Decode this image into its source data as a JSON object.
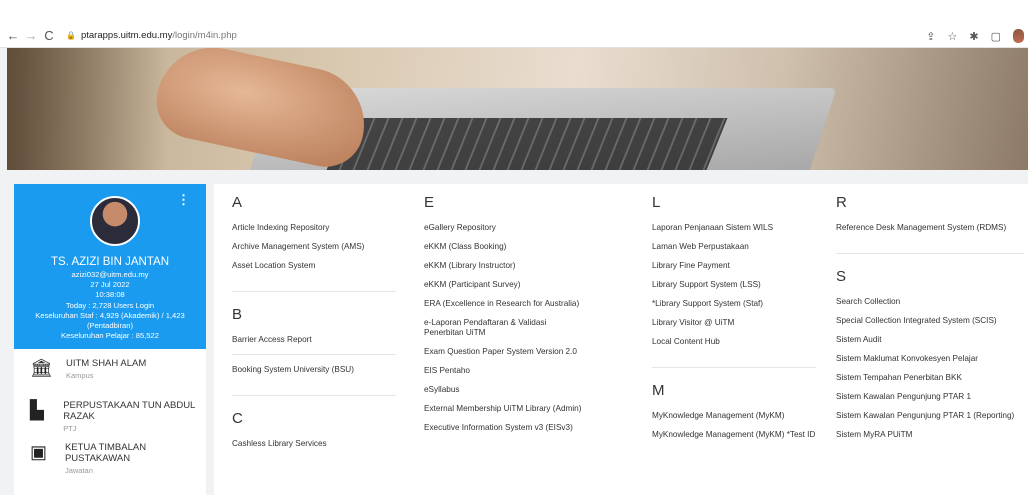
{
  "browser": {
    "url_host": "ptarapps.uitm.edu.my",
    "url_path": "/login/m4in.php"
  },
  "profile": {
    "name": "TS. AZIZI BIN JANTAN",
    "email": "azizi032@uitm.edu.my",
    "date": "27 Jul 2022",
    "time": "10:38:08",
    "today": "Today : 2,728 Users Login",
    "staff1": "Keseluruhan Staf : 4,929 (Akademik) / 1,423",
    "staff2": "(Pentadbiran)",
    "students": "Keseluruhan Pelajar : 85,522",
    "items": [
      {
        "title": "UITM SHAH ALAM",
        "sub": "Kampus",
        "icon": "institution-icon"
      },
      {
        "title": "PERPUSTAKAAN TUN ABDUL RAZAK",
        "sub": "PTJ",
        "icon": "office-desk-icon"
      },
      {
        "title": "KETUA TIMBALAN PUSTAKAWAN",
        "sub": "Jawatan",
        "icon": "id-card-icon"
      }
    ]
  },
  "systems": {
    "A": {
      "letter": "A",
      "items": [
        "Article Indexing Repository",
        "Archive Management System (AMS)",
        "Asset Location System"
      ]
    },
    "B": {
      "letter": "B",
      "items": [
        "Barrier Access Report",
        "Booking System University (BSU)"
      ]
    },
    "C": {
      "letter": "C",
      "items": [
        "Cashless Library Services"
      ]
    },
    "E": {
      "letter": "E",
      "items": [
        "eGallery Repository",
        "eKKM (Class Booking)",
        "eKKM (Library Instructor)",
        "eKKM (Participant Survey)",
        "ERA (Excellence in Research for Australia)",
        "e-Laporan Pendaftaran & Validasi Penerbitan UiTM",
        "Exam Question Paper System Version 2.0",
        "EIS Pentaho",
        "eSyllabus",
        "External Membership UiTM Library (Admin)",
        "Executive Information System v3 (EISv3)"
      ]
    },
    "L": {
      "letter": "L",
      "items": [
        "Laporan Penjanaan Sistem WILS",
        "Laman Web Perpustakaan",
        "Library Fine Payment",
        "Library Support System (LSS)",
        "*Library Support System (Staf)",
        "Library Visitor @ UiTM",
        "Local Content Hub"
      ]
    },
    "M": {
      "letter": "M",
      "items": [
        "MyKnowledge Management (MyKM)",
        "MyKnowledge Management (MyKM) *Test ID"
      ]
    },
    "R": {
      "letter": "R",
      "items": [
        "Reference Desk Management System (RDMS)"
      ]
    },
    "S": {
      "letter": "S",
      "items": [
        "Search Collection",
        "Special Collection Integrated System (SCIS)",
        "Sistem Audit",
        "Sistem Maklumat Konvokesyen Pelajar",
        "Sistem Tempahan Penerbitan BKK",
        "Sistem Kawalan Pengunjung PTAR 1",
        "Sistem Kawalan Pengunjung PTAR 1 (Reporting)",
        "Sistem MyRA PUiTM"
      ]
    }
  }
}
